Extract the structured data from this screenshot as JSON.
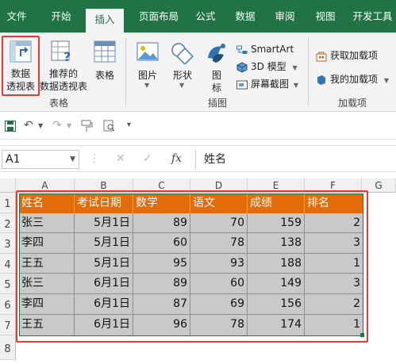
{
  "tabs": [
    "文件",
    "开始",
    "插入",
    "页面布局",
    "公式",
    "数据",
    "审阅",
    "视图",
    "开发工具"
  ],
  "active_tab_index": 2,
  "ribbon": {
    "pivot_table": [
      "数据",
      "透视表"
    ],
    "recommended_pivot": [
      "推荐的",
      "数据透视表"
    ],
    "table": "表格",
    "group_tables": "表格",
    "pictures": "图片",
    "shapes": "形状",
    "icons": [
      "图",
      "标"
    ],
    "group_illustrations": "插图",
    "smartart": "SmartArt",
    "model3d": "3D 模型",
    "screenshot": "屏幕截图",
    "get_addins": "获取加载项",
    "my_addins": "我的加载项",
    "group_addins": "加载项"
  },
  "formula_bar": {
    "name_box": "A1",
    "fx": "fx",
    "formula": "姓名"
  },
  "columns": [
    "A",
    "B",
    "C",
    "D",
    "E",
    "F",
    "G"
  ],
  "rows": [
    "1",
    "2",
    "3",
    "4",
    "5",
    "6",
    "7",
    "8"
  ],
  "table": {
    "headers": [
      "姓名",
      "考试日期",
      "数学",
      "语文",
      "成绩",
      "排名"
    ],
    "rows": [
      [
        "张三",
        "5月1日",
        "89",
        "70",
        "159",
        "2"
      ],
      [
        "李四",
        "5月1日",
        "60",
        "78",
        "138",
        "3"
      ],
      [
        "王五",
        "5月1日",
        "95",
        "93",
        "188",
        "1"
      ],
      [
        "张三",
        "6月1日",
        "89",
        "60",
        "149",
        "3"
      ],
      [
        "李四",
        "6月1日",
        "87",
        "69",
        "156",
        "2"
      ],
      [
        "王五",
        "6月1日",
        "96",
        "78",
        "174",
        "1"
      ]
    ]
  },
  "colors": {
    "excel_green": "#217346",
    "header_fill": "#e26b0a",
    "data_fill": "#c9c9c9",
    "annotation_red": "#e53935"
  }
}
